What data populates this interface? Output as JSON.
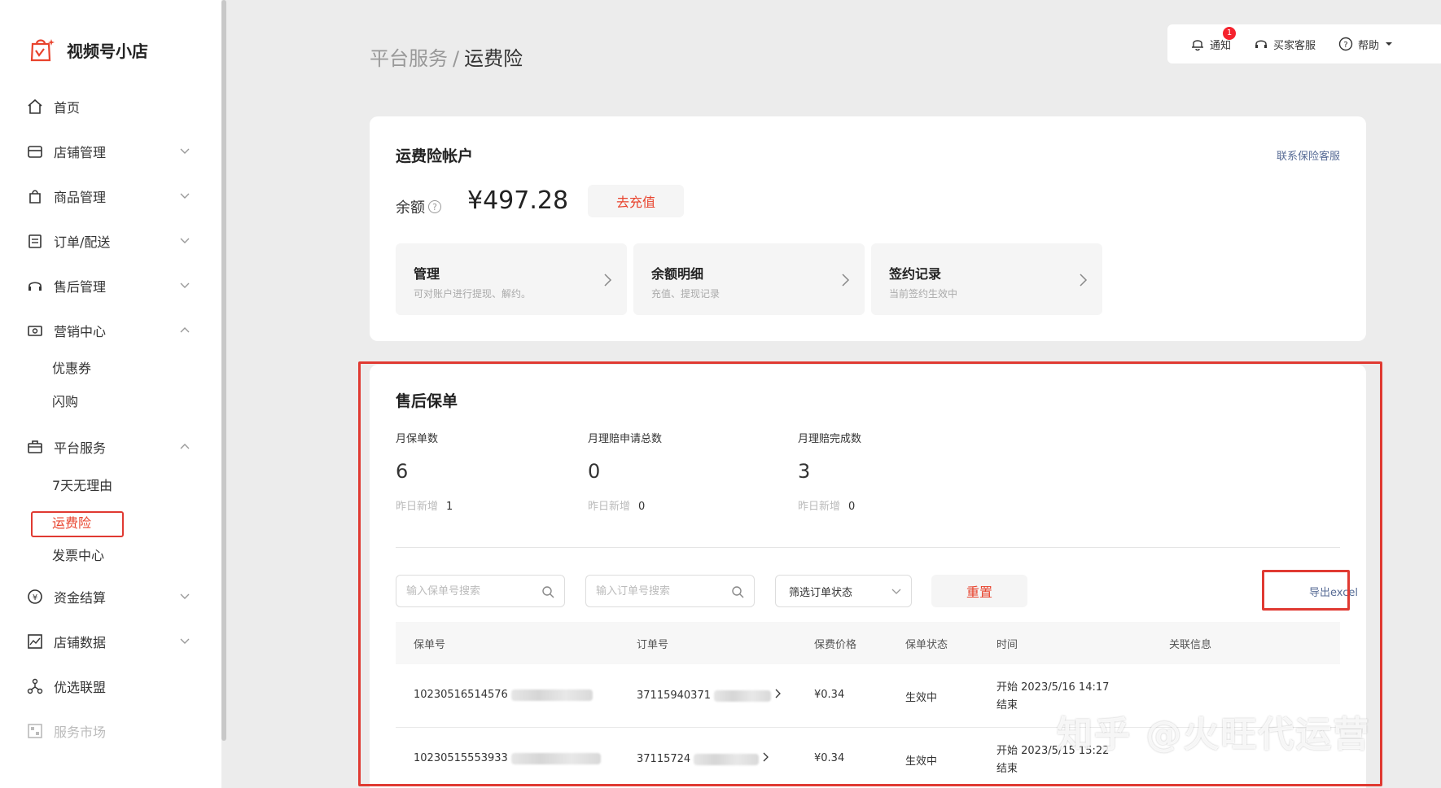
{
  "app": {
    "title": "视频号小店"
  },
  "sidebar": {
    "items": [
      {
        "label": "首页",
        "icon": "home-icon"
      },
      {
        "label": "店铺管理",
        "icon": "store-icon"
      },
      {
        "label": "商品管理",
        "icon": "bag-icon"
      },
      {
        "label": "订单/配送",
        "icon": "order-icon"
      },
      {
        "label": "售后管理",
        "icon": "headset-icon"
      },
      {
        "label": "营销中心",
        "icon": "ticket-icon"
      },
      {
        "label": "平台服务",
        "icon": "briefcase-icon"
      },
      {
        "label": "资金结算",
        "icon": "yen-icon"
      },
      {
        "label": "店铺数据",
        "icon": "chart-icon"
      },
      {
        "label": "优选联盟",
        "icon": "network-icon"
      },
      {
        "label": "服务市场",
        "icon": "market-icon"
      }
    ],
    "marketing_sub": [
      "优惠券",
      "闪购"
    ],
    "platform_sub": [
      "7天无理由",
      "运费险",
      "发票中心"
    ]
  },
  "breadcrumb": {
    "parent": "平台服务",
    "separator": "/",
    "current": "运费险"
  },
  "top_actions": {
    "notify": "通知",
    "notify_count": "1",
    "support": "买家客服",
    "help": "帮助"
  },
  "account": {
    "title": "运费险帐户",
    "contact": "联系保险客服",
    "balance_label": "余额",
    "balance_value": "¥497.28",
    "recharge": "去充值",
    "cards": [
      {
        "title": "管理",
        "desc": "可对账户进行提现、解约。"
      },
      {
        "title": "余额明细",
        "desc": "充值、提现记录"
      },
      {
        "title": "签约记录",
        "desc": "当前签约生效中"
      }
    ]
  },
  "policy": {
    "title": "售后保单",
    "stats": [
      {
        "label": "月保单数",
        "value": "6",
        "yesterday_label": "昨日新增",
        "yesterday_value": "1"
      },
      {
        "label": "月理赔申请总数",
        "value": "0",
        "yesterday_label": "昨日新增",
        "yesterday_value": "0"
      },
      {
        "label": "月理赔完成数",
        "value": "3",
        "yesterday_label": "昨日新增",
        "yesterday_value": "0"
      }
    ],
    "search_policy_placeholder": "输入保单号搜索",
    "search_order_placeholder": "输入订单号搜索",
    "status_filter": "筛选订单状态",
    "reset": "重置",
    "export": "导出excel",
    "columns": [
      "保单号",
      "订单号",
      "保费价格",
      "保单状态",
      "时间",
      "关联信息"
    ],
    "rows": [
      {
        "policy_no": "10230516514576",
        "order_no": "37115940371",
        "price": "¥0.34",
        "status": "生效中",
        "start": "开始 2023/5/16 14:17",
        "end": "结束"
      },
      {
        "policy_no": "10230515553933",
        "order_no": "37115724",
        "price": "¥0.34",
        "status": "生效中",
        "start": "开始 2023/5/15 15:22",
        "end": "结束"
      }
    ]
  },
  "watermark": "知乎 @火旺代运营",
  "colors": {
    "accent": "#e8432d",
    "highlight": "#e03a32",
    "link": "#576b95"
  }
}
